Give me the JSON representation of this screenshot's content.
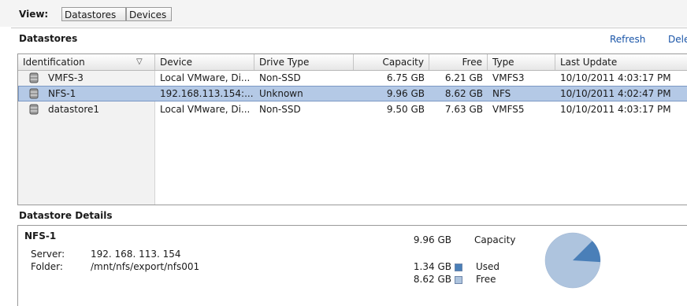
{
  "view": {
    "label": "View:",
    "tabs": [
      {
        "label": "Datastores",
        "selected": true
      },
      {
        "label": "Devices",
        "selected": false
      }
    ]
  },
  "datastores": {
    "title": "Datastores",
    "refresh_label": "Refresh",
    "delete_label": "Dele",
    "columns": {
      "identification": "Identification",
      "device": "Device",
      "drive_type": "Drive Type",
      "capacity": "Capacity",
      "free": "Free",
      "type": "Type",
      "last_update": "Last Update"
    },
    "rows": [
      {
        "name": "VMFS-3",
        "device": "Local VMware, Di...",
        "drive_type": "Non-SSD",
        "capacity": "6.75 GB",
        "free": "6.21 GB",
        "type": "VMFS3",
        "last_update": "10/10/2011 4:03:17 PM",
        "selected": false
      },
      {
        "name": "NFS-1",
        "device": "192.168.113.154:...",
        "drive_type": "Unknown",
        "capacity": "9.96 GB",
        "free": "8.62 GB",
        "type": "NFS",
        "last_update": "10/10/2011 4:02:47 PM",
        "selected": true
      },
      {
        "name": "datastore1",
        "device": "Local VMware, Di...",
        "drive_type": "Non-SSD",
        "capacity": "9.50 GB",
        "free": "7.63 GB",
        "type": "VMFS5",
        "last_update": "10/10/2011 4:03:17 PM",
        "selected": false
      }
    ]
  },
  "details": {
    "title": "Datastore Details",
    "name": "NFS-1",
    "server_label": "Server:",
    "server": "192. 168. 113. 154",
    "folder_label": "Folder:",
    "folder": "/mnt/nfs/export/nfs001",
    "capacity_amount": "9.96 GB",
    "capacity_label": "Capacity",
    "used_amount": "1.34 GB",
    "used_label": "Used",
    "free_amount": "8.62 GB",
    "free_label": "Free",
    "used_fraction": 0.1345,
    "colors": {
      "used": "#4a7fb8",
      "free": "#aec4de"
    }
  }
}
